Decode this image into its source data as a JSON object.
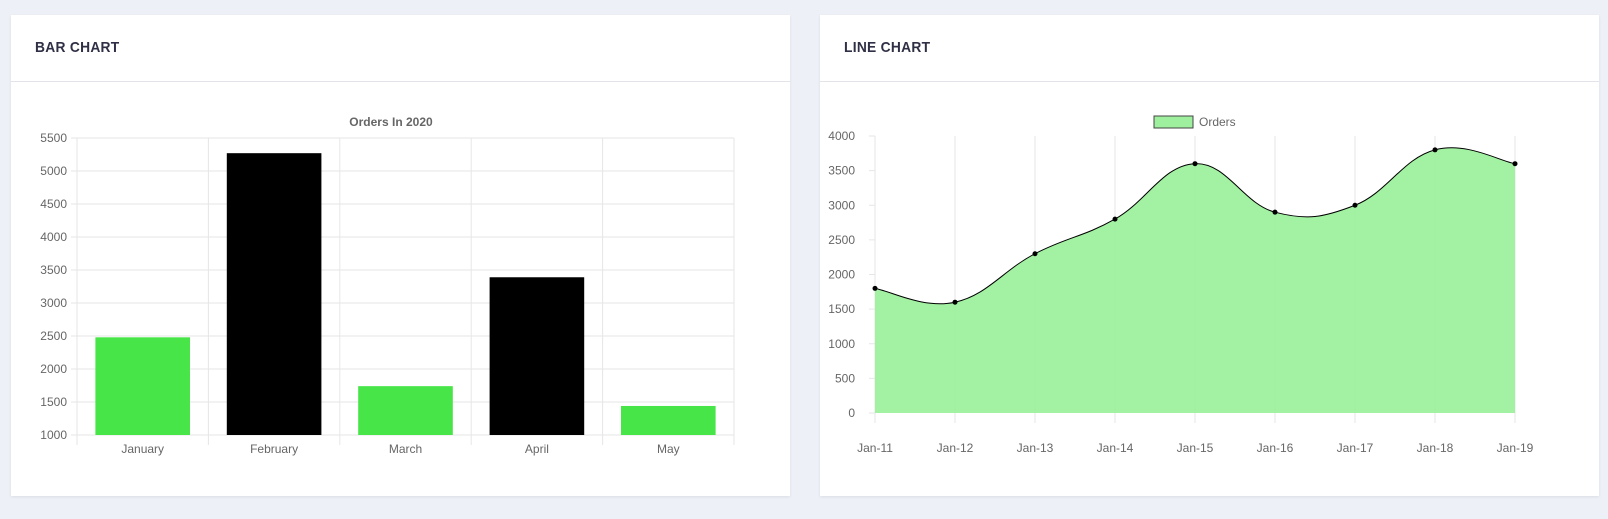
{
  "cards": {
    "bar": {
      "title": "BAR CHART"
    },
    "line": {
      "title": "LINE CHART"
    }
  },
  "colors": {
    "page_background": "#eef0f8",
    "bar_green": "#47e547",
    "bar_black": "#000000",
    "area_fill": "#9ef09e",
    "line_stroke": "#000000",
    "grid": "#e6e6e6",
    "tick_text": "#666666"
  },
  "chart_data": [
    {
      "type": "bar",
      "title": "Orders In 2020",
      "categories": [
        "January",
        "February",
        "March",
        "April",
        "May"
      ],
      "values": [
        2480,
        5270,
        1740,
        3390,
        1440
      ],
      "bar_colors": [
        "#47e547",
        "#000000",
        "#47e547",
        "#000000",
        "#47e547"
      ],
      "ylim": [
        1000,
        5500
      ],
      "yticks": [
        1000,
        1500,
        2000,
        2500,
        3000,
        3500,
        4000,
        4500,
        5000,
        5500
      ],
      "grid": true,
      "legend": "none"
    },
    {
      "type": "area",
      "title": "",
      "legend": "top-center",
      "series": [
        {
          "name": "Orders",
          "values": [
            1800,
            1600,
            2300,
            2800,
            3600,
            2900,
            3000,
            3800,
            3600
          ]
        }
      ],
      "categories": [
        "Jan-11",
        "Jan-12",
        "Jan-13",
        "Jan-14",
        "Jan-15",
        "Jan-16",
        "Jan-17",
        "Jan-18",
        "Jan-19"
      ],
      "ylim": [
        0,
        4000
      ],
      "yticks": [
        0,
        500,
        1000,
        1500,
        2000,
        2500,
        3000,
        3500,
        4000
      ],
      "grid": true,
      "smooth": true
    }
  ]
}
